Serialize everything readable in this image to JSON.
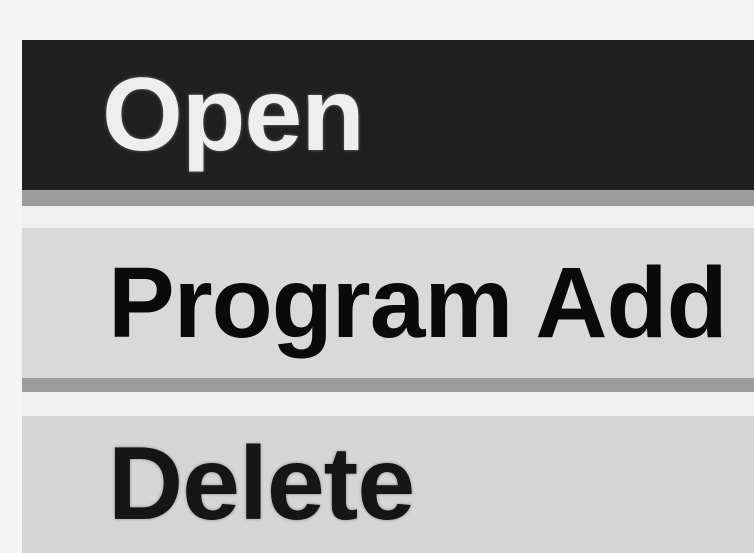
{
  "menu": {
    "items": [
      {
        "label": "Open",
        "state": "highlighted"
      },
      {
        "label": "Program Add",
        "state": "selected"
      },
      {
        "label": "Delete",
        "state": "normal"
      }
    ]
  },
  "colors": {
    "highlight_background": "#202020",
    "highlight_text": "#eeeeee",
    "item_background": "#d9d9d9",
    "item_text": "#0a0a0a"
  }
}
